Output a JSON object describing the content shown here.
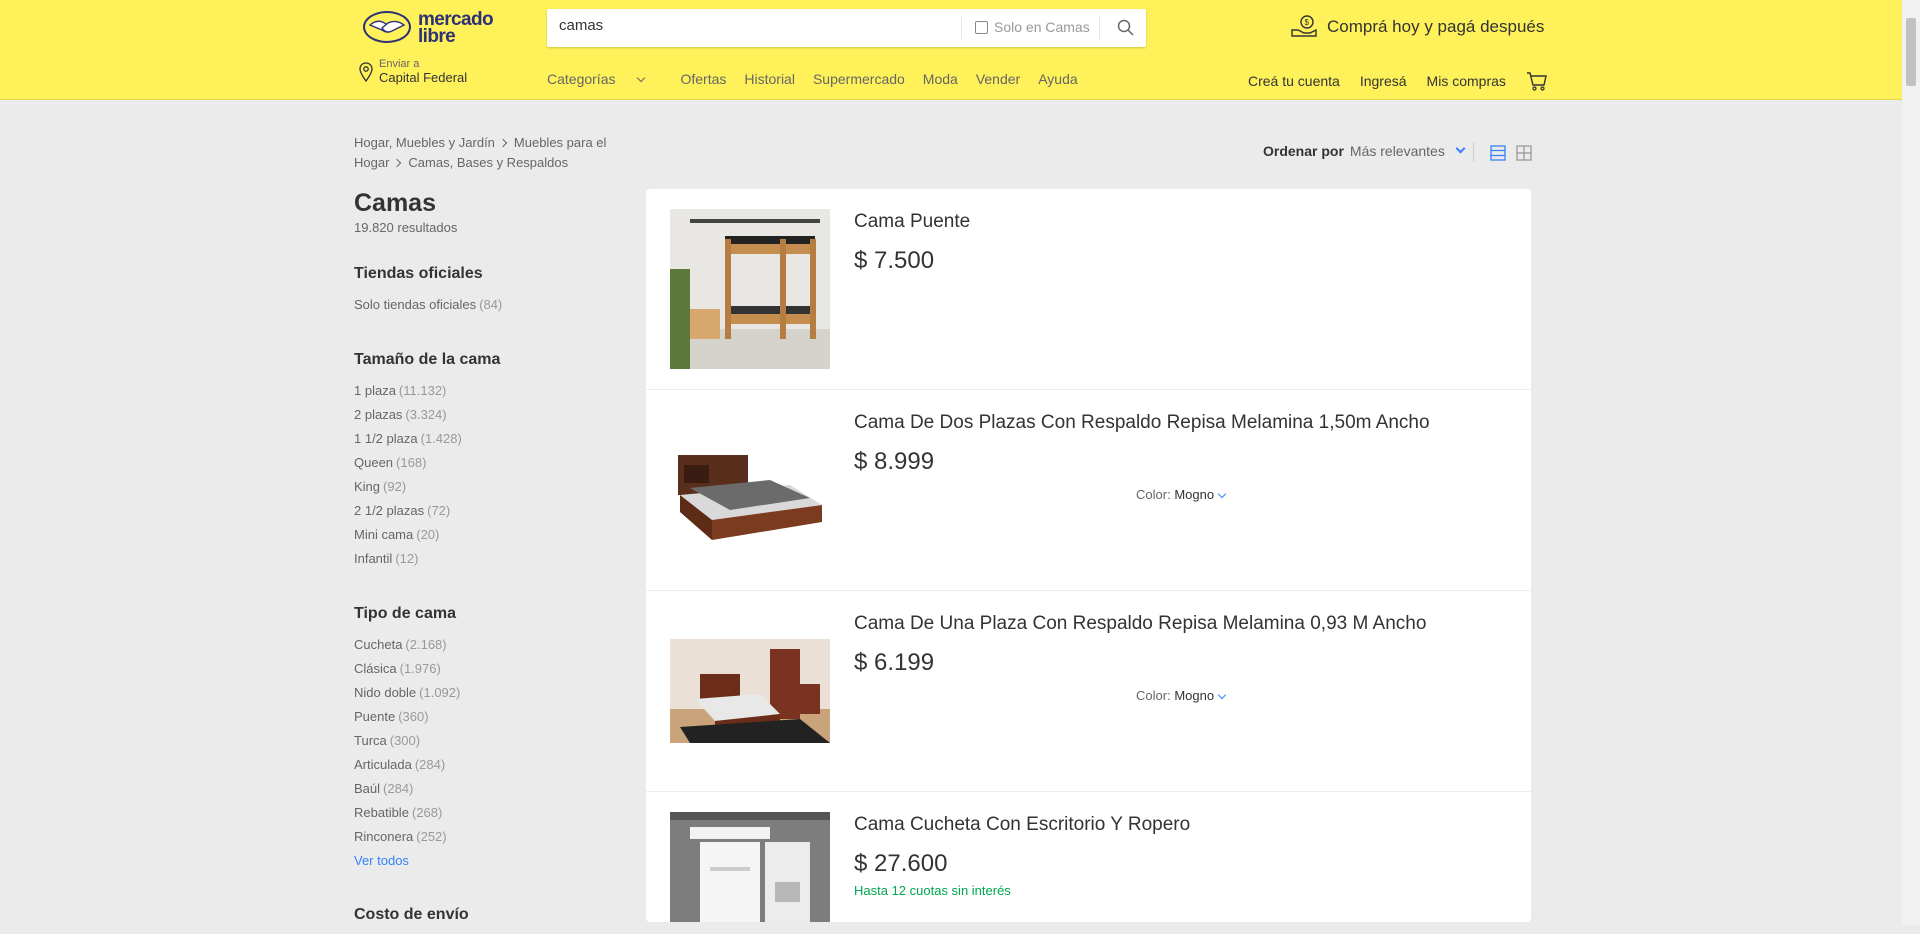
{
  "header": {
    "logo_line1": "mercado",
    "logo_line2": "libre",
    "search_value": "camas",
    "solo_label": "Solo en Camas",
    "promo": "Comprá hoy y pagá después",
    "location_small": "Enviar a",
    "location_big": "Capital Federal",
    "nav": [
      "Categorías",
      "Ofertas",
      "Historial",
      "Supermercado",
      "Moda",
      "Vender",
      "Ayuda"
    ],
    "user_links": [
      "Creá tu cuenta",
      "Ingresá",
      "Mis compras"
    ],
    "brand_color": "#fff159"
  },
  "breadcrumb": [
    "Hogar, Muebles y Jardín",
    "Muebles para el Hogar",
    "Camas, Bases y Respaldos"
  ],
  "sort": {
    "label": "Ordenar por",
    "value": "Más relevantes"
  },
  "sidebar": {
    "title": "Camas",
    "results": "19.820 resultados",
    "groups": [
      {
        "title": "Tiendas oficiales",
        "items": [
          {
            "label": "Solo tiendas oficiales",
            "count": "(84)"
          }
        ]
      },
      {
        "title": "Tamaño de la cama",
        "items": [
          {
            "label": "1 plaza",
            "count": "(11.132)"
          },
          {
            "label": "2 plazas",
            "count": "(3.324)"
          },
          {
            "label": "1 1/2 plaza",
            "count": "(1.428)"
          },
          {
            "label": "Queen",
            "count": "(168)"
          },
          {
            "label": "King",
            "count": "(92)"
          },
          {
            "label": "2 1/2 plazas",
            "count": "(72)"
          },
          {
            "label": "Mini cama",
            "count": "(20)"
          },
          {
            "label": "Infantil",
            "count": "(12)"
          }
        ]
      },
      {
        "title": "Tipo de cama",
        "items": [
          {
            "label": "Cucheta",
            "count": "(2.168)"
          },
          {
            "label": "Clásica",
            "count": "(1.976)"
          },
          {
            "label": "Nido doble",
            "count": "(1.092)"
          },
          {
            "label": "Puente",
            "count": "(360)"
          },
          {
            "label": "Turca",
            "count": "(300)"
          },
          {
            "label": "Articulada",
            "count": "(284)"
          },
          {
            "label": "Baúl",
            "count": "(284)"
          },
          {
            "label": "Rebatible",
            "count": "(268)"
          },
          {
            "label": "Rinconera",
            "count": "(252)"
          }
        ]
      }
    ],
    "ver_todos": "Ver todos",
    "next_group": "Costo de envío"
  },
  "items": [
    {
      "title": "Cama Puente",
      "price": "$ 7.500"
    },
    {
      "title": "Cama De Dos Plazas Con Respaldo Repisa Melamina 1,50m Ancho",
      "price": "$ 8.999",
      "var_label": "Color:",
      "var_value": "Mogno"
    },
    {
      "title": "Cama De Una Plaza Con Respaldo Repisa Melamina 0,93 M Ancho",
      "price": "$ 6.199",
      "var_label": "Color:",
      "var_value": "Mogno"
    },
    {
      "title": "Cama Cucheta Con Escritorio Y Ropero",
      "price": "$ 27.600",
      "installments": "Hasta 12 cuotas sin interés"
    }
  ]
}
